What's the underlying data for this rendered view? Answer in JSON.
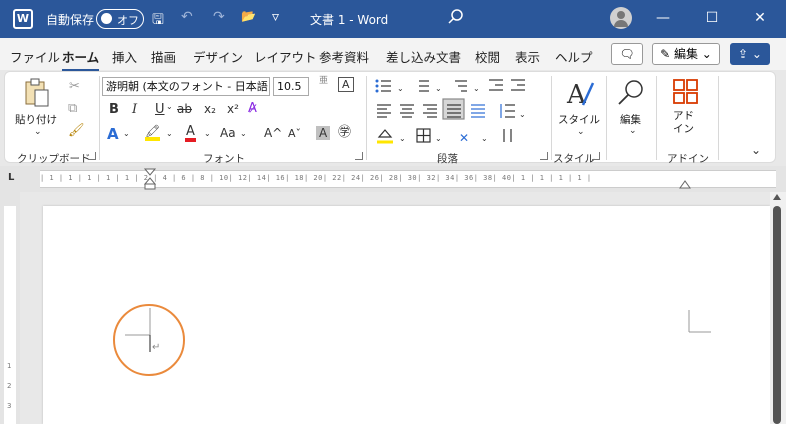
{
  "titlebar": {
    "logo": "W",
    "autosave_label": "自動保存",
    "autosave_state": "オフ",
    "save_icon": "🖫",
    "undo_icon": "↶",
    "redo_icon": "↷",
    "open_icon": "📂",
    "qa_more": "▿",
    "doc_title": "文書 1  -  Word",
    "minimize": "—",
    "maximize": "☐",
    "close": "✕"
  },
  "tabs": [
    "ファイル",
    "ホーム",
    "挿入",
    "描画",
    "デザイン",
    "レイアウト",
    "参考資料",
    "差し込み文書",
    "校閲",
    "表示",
    "ヘルプ"
  ],
  "tab_buttons": {
    "comment": "🗨",
    "edit": "✎ 編集 ⌄",
    "share": "⇪ ⌄"
  },
  "ribbon": {
    "clipboard": {
      "paste_label": "貼り付け",
      "group_label": "クリップボード"
    },
    "font": {
      "font_name": "游明朝 (本文のフォント - 日本語",
      "font_size": "10.5",
      "bold": "B",
      "italic": "I",
      "underline": "U",
      "strike": "ab",
      "subscript": "x₂",
      "superscript": "x²",
      "text_effects": "A",
      "highlight": "🖍",
      "font_color": "A",
      "change_case": "Aa",
      "grow": "A^",
      "shrink": "Aˇ",
      "char_shading": "A",
      "enclose": "㊫",
      "furigana": "亜",
      "char_border": "A",
      "group_label": "フォント"
    },
    "paragraph": {
      "group_label": "段落"
    },
    "styles": {
      "label": "スタイル",
      "group_label": "スタイル"
    },
    "editing": {
      "label": "編集"
    },
    "addins": {
      "label": "アド\nイン",
      "group_label": "アドイン"
    },
    "collapse": "⌄"
  },
  "ruler": {
    "ticks": "| 1 | 1 | 1 | 1 | 1 |   2 | 4 | 6 | 8 | 10| 12| 14| 16| 18| 20| 22| 24| 26| 28| 30| 32| 34| 36| 38| 40| 1 | 1 | 1 | 1 |"
  },
  "vruler": [
    "1",
    "2",
    "3"
  ],
  "page": {
    "paragraph_mark": "↵"
  }
}
